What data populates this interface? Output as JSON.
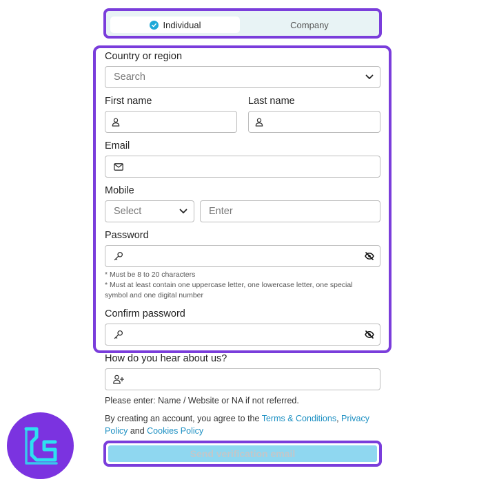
{
  "tabs": {
    "individual": "Individual",
    "company": "Company"
  },
  "form": {
    "country_label": "Country or region",
    "country_placeholder": "Search",
    "first_name_label": "First name",
    "last_name_label": "Last name",
    "email_label": "Email",
    "mobile_label": "Mobile",
    "mobile_code_placeholder": "Select",
    "mobile_number_placeholder": "Enter",
    "password_label": "Password",
    "password_hint_1": "* Must be 8 to 20 characters",
    "password_hint_2": "* Must at least contain one uppercase letter, one lowercase letter, one special symbol and one digital number",
    "confirm_password_label": "Confirm password",
    "referral_label": "How do you hear about us?",
    "referral_hint": "Please enter: Name / Website or NA if not referred."
  },
  "terms": {
    "prefix": "By creating an account, you agree to the ",
    "terms_link": "Terms & Conditions",
    "comma": ", ",
    "privacy_link": "Privacy Policy",
    "and": " and ",
    "cookies_link": "Cookies Policy"
  },
  "submit_label": "Send verification email",
  "colors": {
    "highlight": "#7a3ddb",
    "accent": "#1ea8d8",
    "link": "#1b8fc2",
    "button": "#8fd7f0",
    "logo_bg": "#7b33e0",
    "logo_fg": "#2ee0f0"
  },
  "icons": {
    "check": "check-circle-icon",
    "chevron": "chevron-down-icon",
    "user": "user-icon",
    "mail": "mail-icon",
    "key": "key-icon",
    "eye_off": "eye-off-icon",
    "user_plus": "user-plus-icon",
    "logo": "brand-logo"
  }
}
